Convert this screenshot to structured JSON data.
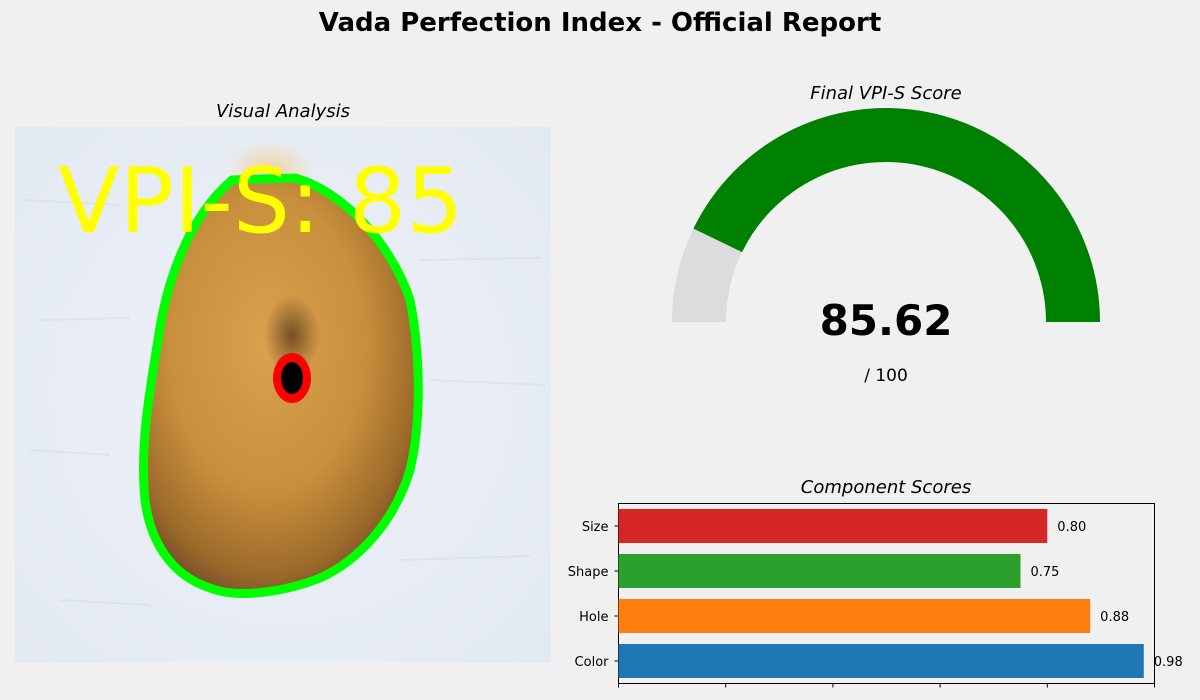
{
  "title": "Vada Perfection Index - Official Report",
  "visual": {
    "title": "Visual Analysis",
    "overlay_text": "VPI-S: 85"
  },
  "gauge": {
    "title": "Final VPI-S Score",
    "score": 85.62,
    "score_text": "85.62",
    "max": 100,
    "max_text": "/ 100",
    "fill_color": "#008000",
    "track_color": "#dcdcdc"
  },
  "chart_data": {
    "type": "bar",
    "orientation": "horizontal",
    "title": "Component Scores",
    "categories": [
      "Color",
      "Hole",
      "Shape",
      "Size"
    ],
    "values": [
      0.98,
      0.88,
      0.75,
      0.8
    ],
    "value_labels": [
      "0.98",
      "0.88",
      "0.75",
      "0.80"
    ],
    "colors": [
      "#1f77b4",
      "#ff7f0e",
      "#2ca02c",
      "#d62728"
    ],
    "xlim": [
      0,
      1
    ],
    "xticks": [
      0,
      0.2,
      0.4,
      0.6,
      0.8,
      1.0
    ]
  }
}
